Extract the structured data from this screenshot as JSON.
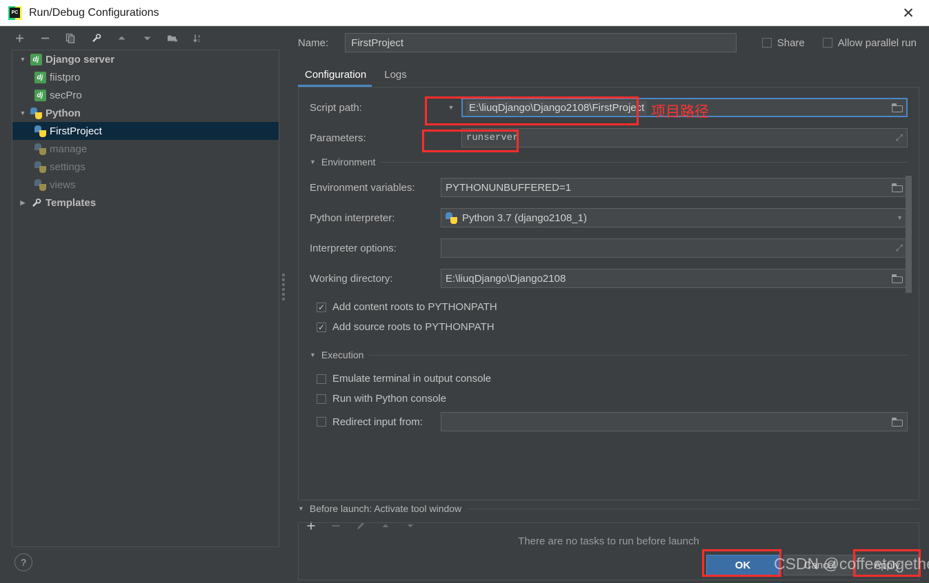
{
  "window": {
    "title": "Run/Debug Configurations",
    "app_icon": "pycharm-icon",
    "icon_letters": "PC",
    "close_label": "✕"
  },
  "sidebar": {
    "toolbar": [
      {
        "name": "add-configuration-button",
        "glyph": "+"
      },
      {
        "name": "remove-configuration-button",
        "glyph": "−"
      },
      {
        "name": "copy-configuration-button",
        "glyph": "copy-icon"
      },
      {
        "name": "edit-templates-button",
        "glyph": "wrench-icon"
      },
      {
        "name": "move-up-button",
        "glyph": "▲"
      },
      {
        "name": "move-down-button",
        "glyph": "▼"
      },
      {
        "name": "new-folder-button",
        "glyph": "folder-plus-icon"
      },
      {
        "name": "sort-configurations-button",
        "glyph": "sort-az-icon"
      }
    ],
    "tree": [
      {
        "label": "Django server",
        "icon": "dj",
        "level": 0,
        "twisty": "▼",
        "group": true,
        "selected": false,
        "dim": false
      },
      {
        "label": "fiistpro",
        "icon": "dj",
        "level": 1,
        "twisty": "",
        "group": false,
        "selected": false,
        "dim": false
      },
      {
        "label": "secPro",
        "icon": "dj",
        "level": 1,
        "twisty": "",
        "group": false,
        "selected": false,
        "dim": false
      },
      {
        "label": "Python",
        "icon": "py",
        "level": 0,
        "twisty": "▼",
        "group": true,
        "selected": false,
        "dim": false
      },
      {
        "label": "FirstProject",
        "icon": "py",
        "level": 1,
        "twisty": "",
        "group": false,
        "selected": true,
        "dim": false
      },
      {
        "label": "manage",
        "icon": "py-dim",
        "level": 1,
        "twisty": "",
        "group": false,
        "selected": false,
        "dim": true
      },
      {
        "label": "settings",
        "icon": "py-dim",
        "level": 1,
        "twisty": "",
        "group": false,
        "selected": false,
        "dim": true
      },
      {
        "label": "views",
        "icon": "py-dim",
        "level": 1,
        "twisty": "",
        "group": false,
        "selected": false,
        "dim": true
      },
      {
        "label": "Templates",
        "icon": "wrench",
        "level": 0,
        "twisty": "▶",
        "group": true,
        "selected": false,
        "dim": false
      }
    ]
  },
  "header": {
    "name_label": "Name:",
    "name_value": "FirstProject",
    "name_placeholder": "",
    "share_label": "Share",
    "share_checked": false,
    "allow_parallel_label": "Allow parallel run",
    "allow_parallel_checked": false
  },
  "tabs": [
    {
      "label": "Configuration",
      "active": true
    },
    {
      "label": "Logs",
      "active": false
    }
  ],
  "form": {
    "script_path": {
      "label": "Script path:",
      "value": "E:\\liuqDjango\\Django2108\\FirstProject",
      "browse_icon": "folder-icon",
      "caret_icon": "chevron-down-icon"
    },
    "parameters": {
      "label": "Parameters:",
      "value": "runserver",
      "expand_icon": "expand-icon"
    },
    "environment_section": {
      "title": "Environment",
      "twisty": "▼"
    },
    "environment_variables": {
      "label": "Environment variables:",
      "value": "PYTHONUNBUFFERED=1",
      "browse_icon": "folder-icon"
    },
    "python_interpreter": {
      "label": "Python interpreter:",
      "value": "Python 3.7 (django2108_1)",
      "icon": "python-icon",
      "caret_icon": "chevron-down-icon"
    },
    "interpreter_options": {
      "label": "Interpreter options:",
      "value": "",
      "expand_icon": "expand-icon"
    },
    "working_directory": {
      "label": "Working directory:",
      "value": "E:\\liuqDjango\\Django2108",
      "browse_icon": "folder-icon"
    },
    "checkboxes": [
      {
        "label": "Add content roots to PYTHONPATH",
        "checked": true,
        "name": "add-content-roots-checkbox"
      },
      {
        "label": "Add source roots to PYTHONPATH",
        "checked": true,
        "name": "add-source-roots-checkbox"
      }
    ],
    "execution_section": {
      "title": "Execution",
      "twisty": "▼"
    },
    "execution_checkboxes": [
      {
        "label": "Emulate terminal in output console",
        "checked": false,
        "name": "emulate-terminal-checkbox"
      },
      {
        "label": "Run with Python console",
        "checked": false,
        "name": "run-with-python-console-checkbox"
      }
    ],
    "redirect_input": {
      "label": "Redirect input from:",
      "checked": false,
      "value": "",
      "browse_icon": "folder-icon"
    }
  },
  "before_launch": {
    "title": "Before launch: Activate tool window",
    "twisty": "▼",
    "toolbar": [
      {
        "name": "add-task-button",
        "glyph": "+",
        "disabled": false
      },
      {
        "name": "remove-task-button",
        "glyph": "−",
        "disabled": true
      },
      {
        "name": "edit-task-button",
        "glyph": "pencil-icon",
        "disabled": true
      },
      {
        "name": "move-task-up-button",
        "glyph": "▲",
        "disabled": true
      },
      {
        "name": "move-task-down-button",
        "glyph": "▼",
        "disabled": true
      }
    ],
    "empty_text": "There are no tasks to run before launch"
  },
  "footer": {
    "help_label": "?",
    "ok_label": "OK",
    "cancel_label": "Cancel",
    "apply_label": "Apply"
  },
  "annotations": {
    "chinese_note": "项目路径",
    "watermark": "CSDN @coffeetogether",
    "highlight_color": "#ff2d2d"
  },
  "colors": {
    "accent": "#4a88c7",
    "ok_button": "#3b6ea5",
    "selection": "#0d293e",
    "background": "#3c3f41",
    "field_bg": "#45484a"
  }
}
